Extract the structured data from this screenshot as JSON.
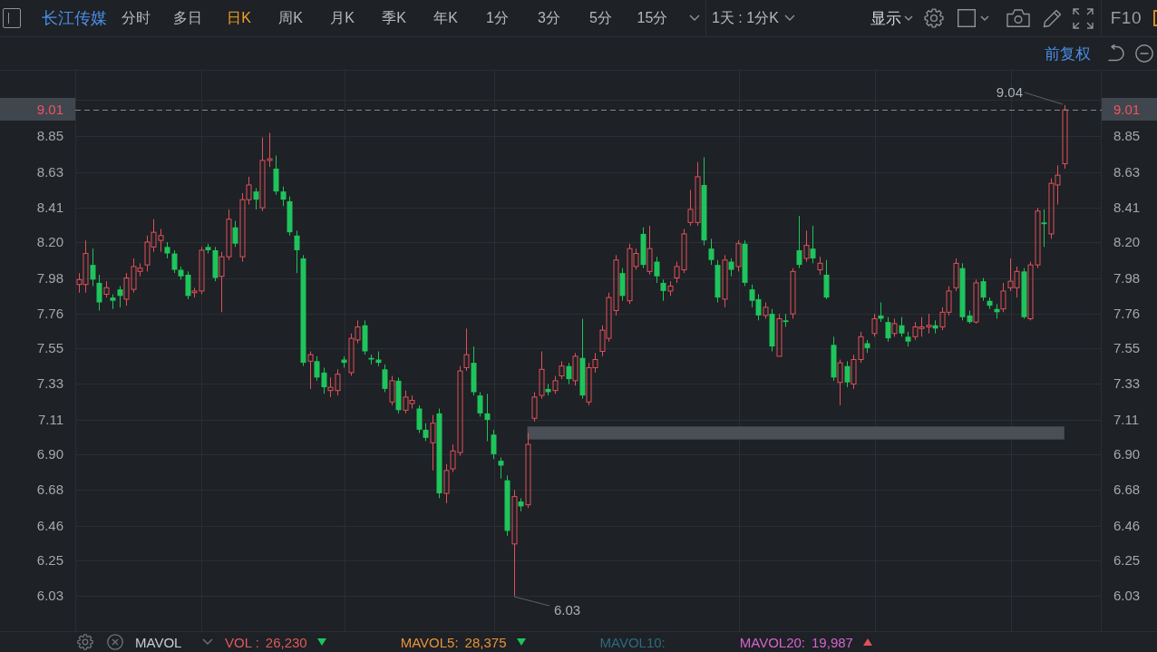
{
  "toolbar": {
    "stock_name": "长江传媒",
    "periods": [
      {
        "label": "分时",
        "selected": false
      },
      {
        "label": "多日",
        "selected": false
      },
      {
        "label": "日K",
        "selected": true
      },
      {
        "label": "周K",
        "selected": false
      },
      {
        "label": "月K",
        "selected": false
      },
      {
        "label": "季K",
        "selected": false
      },
      {
        "label": "年K",
        "selected": false
      },
      {
        "label": "1分",
        "selected": false
      },
      {
        "label": "3分",
        "selected": false
      },
      {
        "label": "5分",
        "selected": false
      },
      {
        "label": "15分",
        "selected": false
      }
    ],
    "interval_dropdown": {
      "value": "1天 : 1分K"
    },
    "display_dropdown": {
      "label": "显示"
    },
    "f10_button": "F10"
  },
  "subbar": {
    "adjustment": "前复权"
  },
  "chart": {
    "left_axis": {
      "current_price": "9.01"
    },
    "right_axis": {
      "current_price": "9.01",
      "ticks": [
        "8.85",
        "8.63",
        "8.41",
        "8.20",
        "7.98",
        "7.76",
        "7.55",
        "7.33",
        "7.11",
        "6.90",
        "6.68",
        "6.46",
        "6.25",
        "6.03"
      ]
    },
    "high_label": "9.04",
    "low_label": "6.03",
    "chart_data": {
      "type": "candlestick",
      "grid": true,
      "ylim": [
        5.81,
        9.25
      ],
      "yticks": [
        {
          "value": 8.85,
          "label": "8.85"
        },
        {
          "value": 8.63,
          "label": "8.63"
        },
        {
          "value": 8.41,
          "label": "8.41"
        },
        {
          "value": 8.2,
          "label": "8.20"
        },
        {
          "value": 7.98,
          "label": "7.98"
        },
        {
          "value": 7.76,
          "label": "7.76"
        },
        {
          "value": 7.55,
          "label": "7.55"
        },
        {
          "value": 7.33,
          "label": "7.33"
        },
        {
          "value": 7.11,
          "label": "7.11"
        },
        {
          "value": 6.9,
          "label": "6.90"
        },
        {
          "value": 6.68,
          "label": "6.68"
        },
        {
          "value": 6.46,
          "label": "6.46"
        },
        {
          "value": 6.25,
          "label": "6.25"
        },
        {
          "value": 6.03,
          "label": "6.03"
        }
      ],
      "ref_lines": [
        {
          "axis": "y",
          "value": 9.01
        }
      ],
      "bands": [
        {
          "axis": "y",
          "from": 6.99,
          "to": 7.07
        }
      ],
      "categories": [
        null,
        null,
        null,
        null,
        null,
        null,
        null,
        null,
        null,
        null,
        null,
        null,
        null,
        null,
        null,
        null,
        null,
        null,
        null,
        null,
        null,
        null,
        null,
        null,
        null,
        null,
        null,
        null,
        null,
        null,
        null,
        null,
        null,
        null,
        null,
        null,
        null,
        null,
        null,
        null,
        null,
        null,
        null,
        null,
        null,
        null,
        null,
        null,
        null,
        null,
        null,
        null,
        null,
        null,
        null,
        null,
        null,
        null,
        null,
        null,
        null,
        null,
        null,
        null,
        null,
        null,
        null,
        null,
        null,
        null,
        null,
        null,
        null,
        null,
        null,
        null,
        null,
        null,
        null,
        null,
        null,
        null,
        null,
        null,
        null,
        null,
        null,
        null,
        null,
        null,
        null,
        null,
        null,
        null,
        null,
        null,
        null,
        null,
        null,
        null,
        null,
        null,
        null,
        null,
        null,
        null,
        null,
        null,
        null,
        null,
        null,
        null,
        null,
        null,
        null,
        null,
        null,
        null,
        null,
        null,
        null,
        null,
        null,
        null,
        null,
        null,
        null,
        null,
        null,
        null,
        null,
        null,
        null,
        null,
        null,
        null,
        null,
        null,
        null,
        null,
        null,
        null,
        null,
        null,
        null,
        null,
        null,
        null,
        null,
        null,
        null
      ],
      "ohlc": [
        [
          7.94,
          8.01,
          7.89,
          7.97
        ],
        [
          7.94,
          8.21,
          7.89,
          8.13
        ],
        [
          8.06,
          8.16,
          7.93,
          7.97
        ],
        [
          7.95,
          8.0,
          7.78,
          7.83
        ],
        [
          7.88,
          7.96,
          7.86,
          7.92
        ],
        [
          7.86,
          7.88,
          7.79,
          7.84
        ],
        [
          7.91,
          7.93,
          7.8,
          7.87
        ],
        [
          7.85,
          8.01,
          7.81,
          7.98
        ],
        [
          7.91,
          8.1,
          7.89,
          8.05
        ],
        [
          8.02,
          8.07,
          7.99,
          8.04
        ],
        [
          8.06,
          8.24,
          8.02,
          8.2
        ],
        [
          8.17,
          8.34,
          8.14,
          8.26
        ],
        [
          8.21,
          8.28,
          8.14,
          8.24
        ],
        [
          8.17,
          8.2,
          8.1,
          8.13
        ],
        [
          8.13,
          8.15,
          8.01,
          8.03
        ],
        [
          8.03,
          8.05,
          7.97,
          7.99
        ],
        [
          8.0,
          8.02,
          7.85,
          7.87
        ],
        [
          7.89,
          7.92,
          7.86,
          7.9
        ],
        [
          7.9,
          8.17,
          7.88,
          8.15
        ],
        [
          8.17,
          8.19,
          8.13,
          8.15
        ],
        [
          8.15,
          8.17,
          7.96,
          7.98
        ],
        [
          7.99,
          8.14,
          7.77,
          8.11
        ],
        [
          8.11,
          8.4,
          8.09,
          8.34
        ],
        [
          8.29,
          8.33,
          8.17,
          8.19
        ],
        [
          8.11,
          8.5,
          8.08,
          8.46
        ],
        [
          8.46,
          8.6,
          8.43,
          8.55
        ],
        [
          8.51,
          8.53,
          8.4,
          8.46
        ],
        [
          8.41,
          8.84,
          8.39,
          8.7
        ],
        [
          8.7,
          8.87,
          8.66,
          8.71
        ],
        [
          8.65,
          8.73,
          8.49,
          8.51
        ],
        [
          8.51,
          8.54,
          8.42,
          8.46
        ],
        [
          8.45,
          8.48,
          8.24,
          8.26
        ],
        [
          8.24,
          8.27,
          8.01,
          8.15
        ],
        [
          8.1,
          8.12,
          7.44,
          7.46
        ],
        [
          7.47,
          7.53,
          7.3,
          7.51
        ],
        [
          7.47,
          7.5,
          7.35,
          7.37
        ],
        [
          7.4,
          7.43,
          7.27,
          7.31
        ],
        [
          7.29,
          7.37,
          7.25,
          7.31
        ],
        [
          7.29,
          7.42,
          7.26,
          7.39
        ],
        [
          7.48,
          7.5,
          7.43,
          7.46
        ],
        [
          7.4,
          7.64,
          7.38,
          7.61
        ],
        [
          7.6,
          7.72,
          7.58,
          7.68
        ],
        [
          7.69,
          7.72,
          7.51,
          7.53
        ],
        [
          7.49,
          7.51,
          7.45,
          7.48
        ],
        [
          7.48,
          7.53,
          7.44,
          7.46
        ],
        [
          7.42,
          7.45,
          7.28,
          7.3
        ],
        [
          7.22,
          7.38,
          7.2,
          7.35
        ],
        [
          7.35,
          7.37,
          7.15,
          7.17
        ],
        [
          7.17,
          7.29,
          7.15,
          7.25
        ],
        [
          7.21,
          7.26,
          7.18,
          7.23
        ],
        [
          7.18,
          7.2,
          7.03,
          7.05
        ],
        [
          7.05,
          7.09,
          6.98,
          7.0
        ],
        [
          6.97,
          7.14,
          6.8,
          7.09
        ],
        [
          7.15,
          7.18,
          6.63,
          6.66
        ],
        [
          6.66,
          6.84,
          6.6,
          6.8
        ],
        [
          6.81,
          6.96,
          6.79,
          6.92
        ],
        [
          6.91,
          7.44,
          6.89,
          7.41
        ],
        [
          7.43,
          7.67,
          7.41,
          7.51
        ],
        [
          7.46,
          7.56,
          7.26,
          7.28
        ],
        [
          7.26,
          7.28,
          7.13,
          7.15
        ],
        [
          7.15,
          7.27,
          6.98,
          7.11
        ],
        [
          7.02,
          7.05,
          6.87,
          6.9
        ],
        [
          6.86,
          6.88,
          6.75,
          6.83
        ],
        [
          6.74,
          6.77,
          6.4,
          6.43
        ],
        [
          6.35,
          6.68,
          6.03,
          6.64
        ],
        [
          6.61,
          6.63,
          6.55,
          6.58
        ],
        [
          6.59,
          7.03,
          6.57,
          6.96
        ],
        [
          7.12,
          7.28,
          7.1,
          7.25
        ],
        [
          7.26,
          7.53,
          7.24,
          7.42
        ],
        [
          7.3,
          7.33,
          7.26,
          7.28
        ],
        [
          7.29,
          7.38,
          7.27,
          7.35
        ],
        [
          7.38,
          7.47,
          7.36,
          7.44
        ],
        [
          7.44,
          7.46,
          7.33,
          7.36
        ],
        [
          7.35,
          7.52,
          7.32,
          7.5
        ],
        [
          7.49,
          7.73,
          7.24,
          7.26
        ],
        [
          7.22,
          7.46,
          7.2,
          7.43
        ],
        [
          7.43,
          7.52,
          7.4,
          7.48
        ],
        [
          7.53,
          7.69,
          7.5,
          7.66
        ],
        [
          7.61,
          7.89,
          7.59,
          7.86
        ],
        [
          7.78,
          8.12,
          7.75,
          8.09
        ],
        [
          8.01,
          8.04,
          7.84,
          7.87
        ],
        [
          7.84,
          8.19,
          7.82,
          8.16
        ],
        [
          8.05,
          8.16,
          8.03,
          8.13
        ],
        [
          8.25,
          8.29,
          8.04,
          8.06
        ],
        [
          8.02,
          8.3,
          8.0,
          8.16
        ],
        [
          8.08,
          8.11,
          7.95,
          7.99
        ],
        [
          7.95,
          7.97,
          7.84,
          7.9
        ],
        [
          7.9,
          7.96,
          7.87,
          7.93
        ],
        [
          7.98,
          8.08,
          7.95,
          8.05
        ],
        [
          8.03,
          8.28,
          8.01,
          8.25
        ],
        [
          8.32,
          8.52,
          8.3,
          8.4
        ],
        [
          8.32,
          8.69,
          8.3,
          8.6
        ],
        [
          8.55,
          8.72,
          8.18,
          8.21
        ],
        [
          8.16,
          8.22,
          8.06,
          8.09
        ],
        [
          8.06,
          8.09,
          7.83,
          7.86
        ],
        [
          7.85,
          8.12,
          7.8,
          8.09
        ],
        [
          8.08,
          8.1,
          7.99,
          8.03
        ],
        [
          8.05,
          8.21,
          8.02,
          8.19
        ],
        [
          8.19,
          8.21,
          7.93,
          7.95
        ],
        [
          7.91,
          7.94,
          7.8,
          7.84
        ],
        [
          7.85,
          7.88,
          7.72,
          7.75
        ],
        [
          7.75,
          7.83,
          7.73,
          7.8
        ],
        [
          7.76,
          7.79,
          7.53,
          7.56
        ],
        [
          7.5,
          7.76,
          7.5,
          7.73
        ],
        [
          7.72,
          7.76,
          7.68,
          7.71
        ],
        [
          7.76,
          8.04,
          7.73,
          8.02
        ],
        [
          8.15,
          8.36,
          8.04,
          8.06
        ],
        [
          8.1,
          8.27,
          8.08,
          8.18
        ],
        [
          8.16,
          8.3,
          8.07,
          8.1
        ],
        [
          8.03,
          8.11,
          8.0,
          8.07
        ],
        [
          8.0,
          8.09,
          7.85,
          7.86
        ],
        [
          7.57,
          7.62,
          7.35,
          7.37
        ],
        [
          7.34,
          7.48,
          7.2,
          7.46
        ],
        [
          7.44,
          7.47,
          7.31,
          7.34
        ],
        [
          7.33,
          7.51,
          7.3,
          7.48
        ],
        [
          7.48,
          7.65,
          7.46,
          7.62
        ],
        [
          7.58,
          7.6,
          7.52,
          7.55
        ],
        [
          7.64,
          7.76,
          7.62,
          7.73
        ],
        [
          7.75,
          7.83,
          7.71,
          7.73
        ],
        [
          7.71,
          7.74,
          7.59,
          7.61
        ],
        [
          7.64,
          7.73,
          7.62,
          7.7
        ],
        [
          7.69,
          7.74,
          7.62,
          7.64
        ],
        [
          7.62,
          7.65,
          7.56,
          7.59
        ],
        [
          7.62,
          7.71,
          7.6,
          7.68
        ],
        [
          7.67,
          7.74,
          7.62,
          7.68
        ],
        [
          7.68,
          7.76,
          7.64,
          7.69
        ],
        [
          7.69,
          7.72,
          7.64,
          7.67
        ],
        [
          7.68,
          7.8,
          7.66,
          7.77
        ],
        [
          7.77,
          7.93,
          7.75,
          7.9
        ],
        [
          7.92,
          8.1,
          7.9,
          8.07
        ],
        [
          8.04,
          8.07,
          7.72,
          7.74
        ],
        [
          7.75,
          7.78,
          7.7,
          7.71
        ],
        [
          7.71,
          7.97,
          7.7,
          7.95
        ],
        [
          7.96,
          7.98,
          7.84,
          7.86
        ],
        [
          7.84,
          7.86,
          7.79,
          7.81
        ],
        [
          7.79,
          7.82,
          7.73,
          7.77
        ],
        [
          7.79,
          7.95,
          7.77,
          7.9
        ],
        [
          7.92,
          8.1,
          7.9,
          7.96
        ],
        [
          7.92,
          8.05,
          7.86,
          8.02
        ],
        [
          8.02,
          8.04,
          7.73,
          7.74
        ],
        [
          7.73,
          8.08,
          7.72,
          8.06
        ],
        [
          8.06,
          8.41,
          8.04,
          8.39
        ],
        [
          8.32,
          8.4,
          8.17,
          8.31
        ],
        [
          8.25,
          8.59,
          8.22,
          8.56
        ],
        [
          8.55,
          8.67,
          8.43,
          8.61
        ],
        [
          8.68,
          9.04,
          8.65,
          9.01
        ],
        null,
        null,
        null,
        null,
        null
      ]
    }
  },
  "legend": {
    "indicator": "MAVOL",
    "series": [
      {
        "label": "VOL :",
        "value": "26,230",
        "rising": false,
        "color": "#e05a5e"
      },
      {
        "label": "MAVOL5:",
        "value": "28,375",
        "rising": false,
        "color": "#e8923c"
      },
      {
        "label": "MAVOL10:",
        "color": "#2c6b80"
      },
      {
        "label": "MAVOL20:",
        "value": "19,987",
        "rising": true,
        "color": "#d663d0"
      }
    ]
  }
}
